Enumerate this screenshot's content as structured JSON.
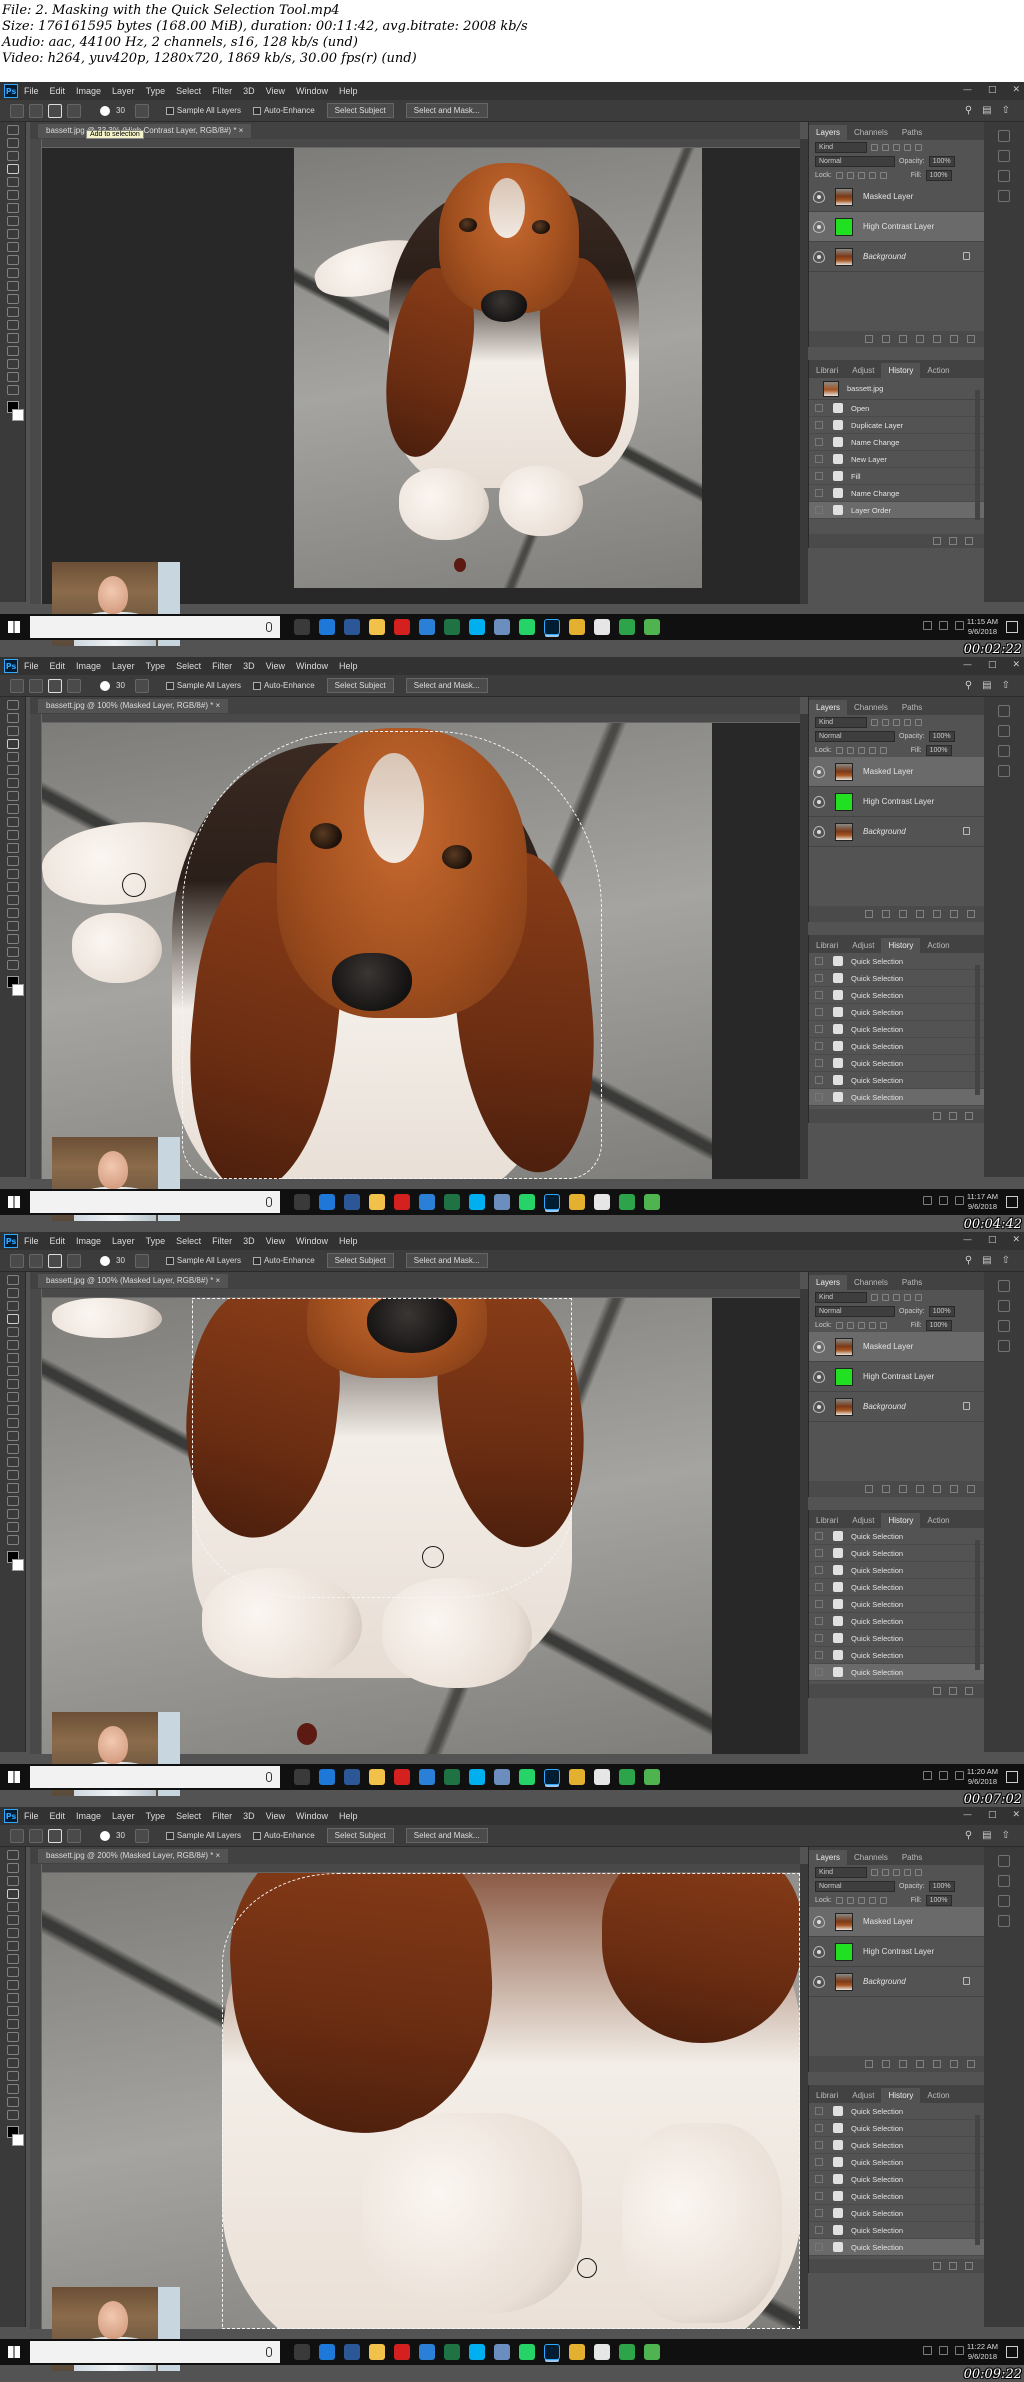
{
  "file_info": {
    "file": "File: 2. Masking with the Quick Selection Tool.mp4",
    "size": "Size: 176161595 bytes (168.00 MiB), duration: 00:11:42, avg.bitrate: 2008 kb/s",
    "audio": "Audio: aac, 44100 Hz, 2 channels, s16, 128 kb/s (und)",
    "video": "Video: h264, yuv420p, 1280x720, 1869 kb/s, 30.00 fps(r) (und)"
  },
  "menubar": {
    "logo": "Ps",
    "items": [
      "File",
      "Edit",
      "Image",
      "Layer",
      "Type",
      "Select",
      "Filter",
      "3D",
      "View",
      "Window",
      "Help"
    ]
  },
  "options_bar": {
    "brush_size": "30",
    "sample_all_layers": "Sample All Layers",
    "auto_enhance": "Auto-Enhance",
    "select_subject": "Select Subject",
    "select_and_mask": "Select and Mask..."
  },
  "tooltip": "Add to selection",
  "layers_panel": {
    "tabs": [
      "Layers",
      "Channels",
      "Paths"
    ],
    "kind": "Kind",
    "blend_mode": "Normal",
    "opacity_label": "Opacity:",
    "opacity_value": "100%",
    "lock_label": "Lock:",
    "fill_label": "Fill:",
    "fill_value": "100%",
    "layers": [
      "Masked Layer",
      "High Contrast Layer",
      "Background"
    ]
  },
  "history_panel": {
    "tabs": [
      "Librari",
      "Adjust",
      "History",
      "Action"
    ],
    "snapshot": "bassett.jpg",
    "frame1_steps": [
      "Open",
      "Duplicate Layer",
      "Name Change",
      "New Layer",
      "Fill",
      "Name Change",
      "Layer Order"
    ],
    "qs_step": "Quick Selection"
  },
  "frames": [
    {
      "doc_tab": "bassett.jpg @ 33.3% (High Contrast Layer, RGB/8#) *",
      "clock_time": "11:15 AM",
      "clock_date": "9/6/2018",
      "timestamp": "00:02:22"
    },
    {
      "doc_tab": "bassett.jpg @ 100% (Masked Layer, RGB/8#) *",
      "clock_time": "11:17 AM",
      "clock_date": "9/6/2018",
      "timestamp": "00:04:42"
    },
    {
      "doc_tab": "bassett.jpg @ 100% (Masked Layer, RGB/8#) *",
      "clock_time": "11:20 AM",
      "clock_date": "9/6/2018",
      "timestamp": "00:07:02"
    },
    {
      "doc_tab": "bassett.jpg @ 200% (Masked Layer, RGB/8#) *",
      "clock_time": "11:22 AM",
      "clock_date": "9/6/2018",
      "timestamp": "00:09:22"
    }
  ],
  "colors": {
    "ps_panel": "#535353",
    "ps_dark": "#323232",
    "high_contrast_fill": "#21e021",
    "taskbar": "#101010"
  },
  "taskbar_icons": [
    "task-view-icon",
    "edge-icon",
    "word-icon",
    "file-explorer-icon",
    "acrobat-icon",
    "vpn-icon",
    "excel-icon",
    "skype-icon",
    "notepad-icon",
    "whatsapp-icon",
    "photoshop-icon",
    "chrome-icon",
    "notes-icon",
    "camtasia-icon",
    "camtasia-recorder-icon"
  ]
}
